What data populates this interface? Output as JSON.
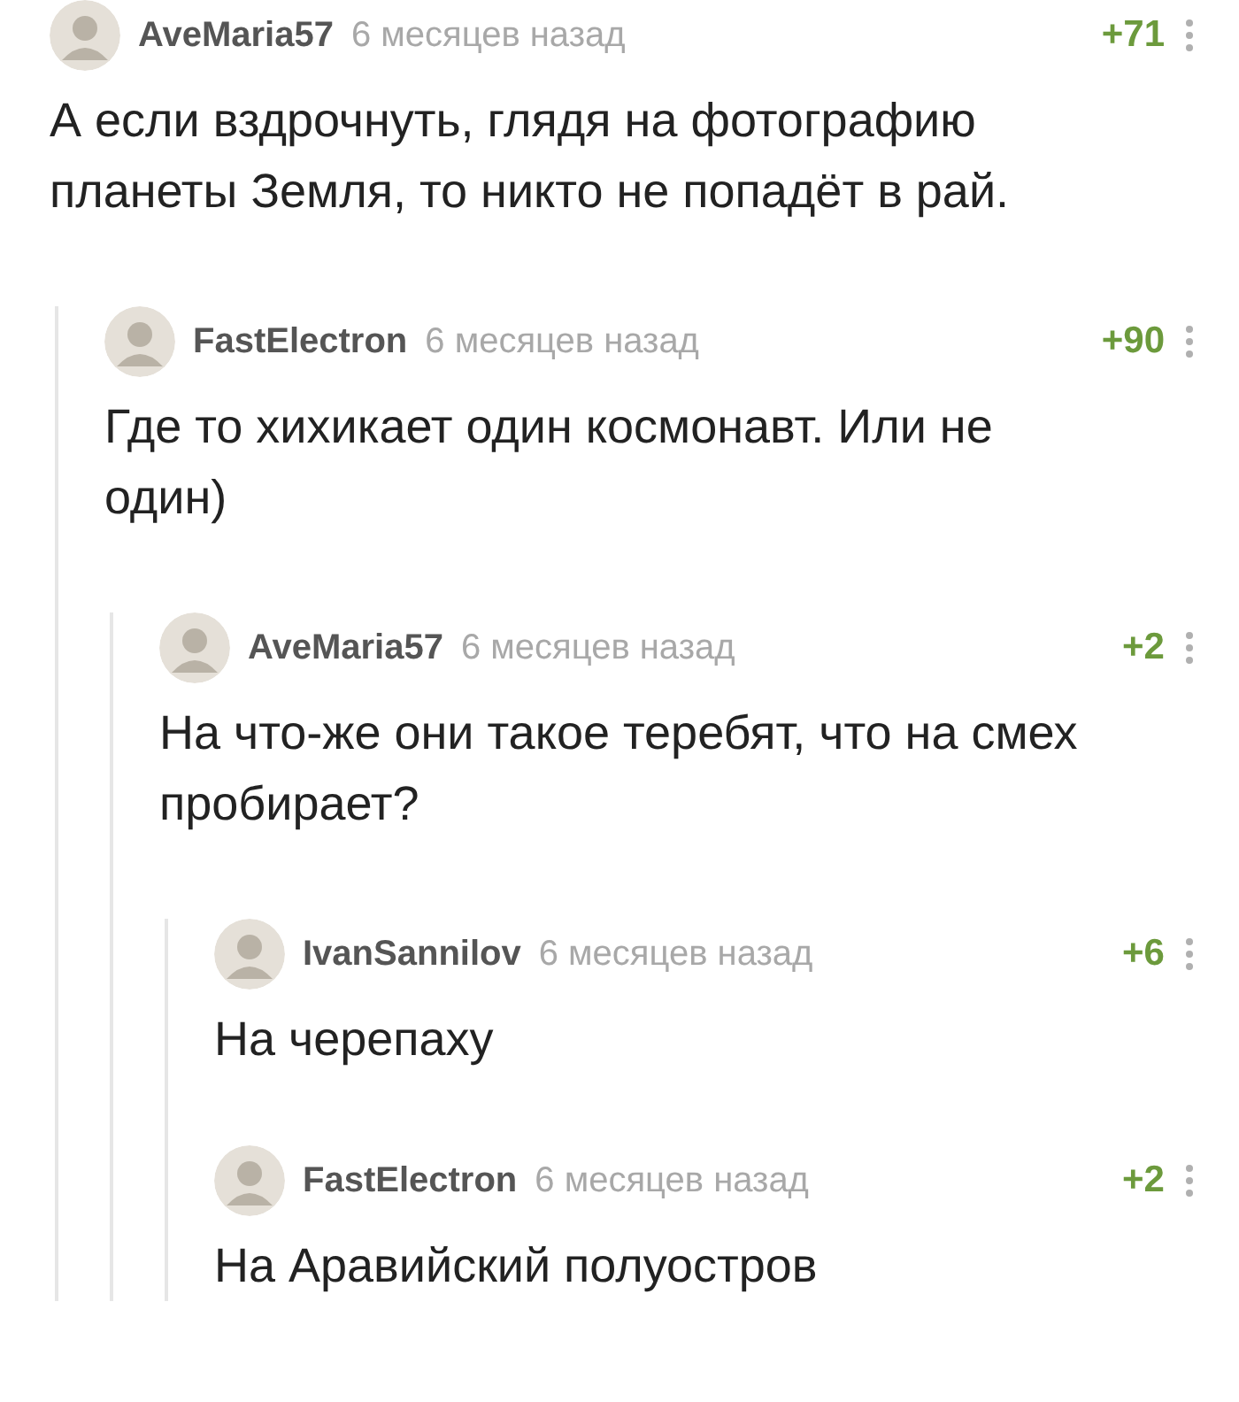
{
  "comments": [
    {
      "author": "AveMaria57",
      "time": "6 месяцев назад",
      "rating": "+71",
      "text": "А если вздрочнуть, глядя на фотографию планеты Земля, то никто не попадёт в рай.",
      "children": [
        {
          "author": "FastElectron",
          "time": "6 месяцев назад",
          "rating": "+90",
          "text": "Где то хихикает один космонавт. Или не один)",
          "children": [
            {
              "author": "AveMaria57",
              "time": "6 месяцев назад",
              "rating": "+2",
              "text": "На что-же они такое теребят, что на смех пробирает?",
              "children": [
                {
                  "author": "IvanSannilov",
                  "time": "6 месяцев назад",
                  "rating": "+6",
                  "text": "На черепаху"
                },
                {
                  "author": "FastElectron",
                  "time": "6 месяцев назад",
                  "rating": "+2",
                  "text": "На Аравийский полуостров"
                }
              ]
            }
          ]
        }
      ]
    }
  ]
}
